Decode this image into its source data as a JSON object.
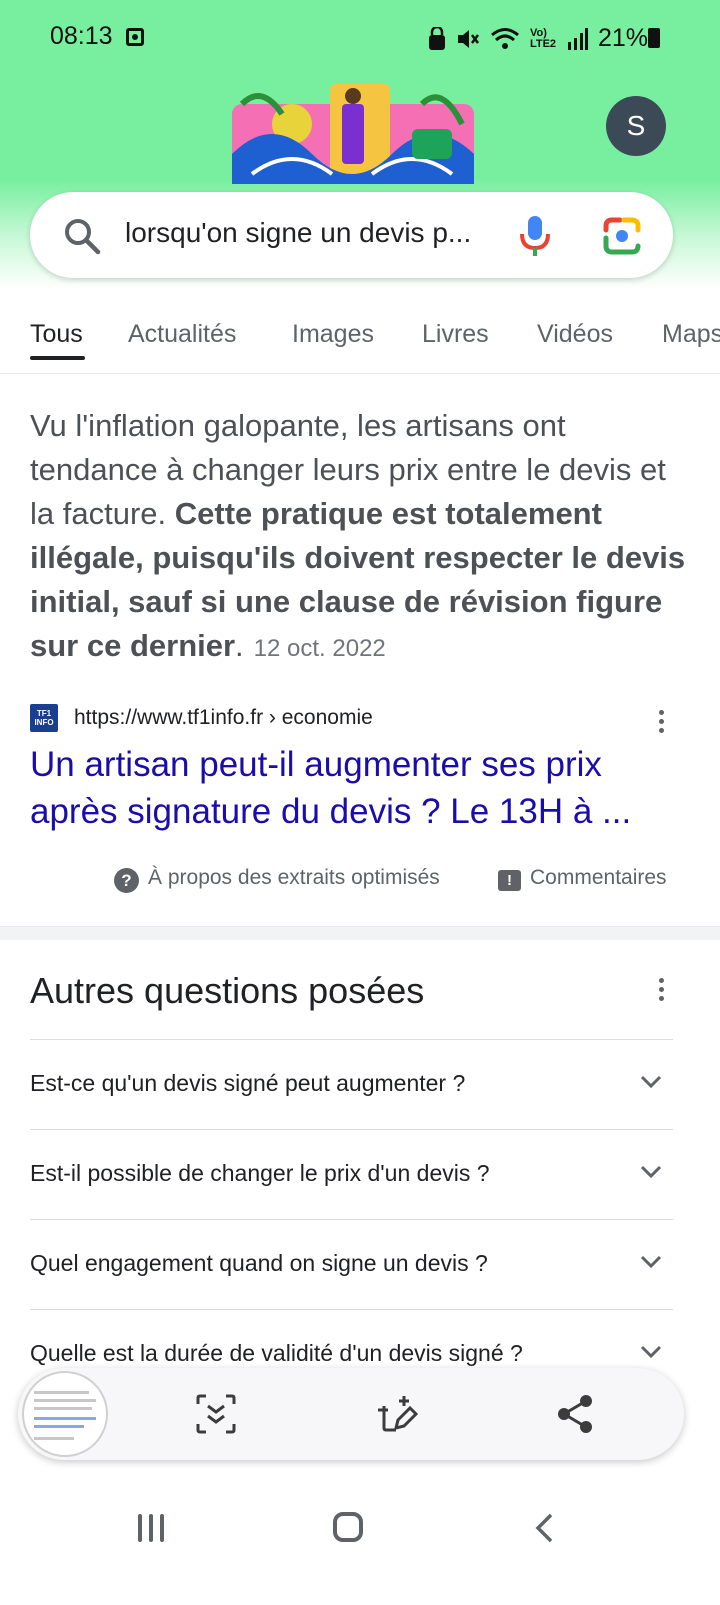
{
  "status_bar": {
    "time": "08:13",
    "network": "Vo) LTE2",
    "battery": "21%"
  },
  "header": {
    "avatar_initial": "S"
  },
  "search": {
    "query": "lorsqu'on signe un devis p..."
  },
  "tabs": [
    {
      "label": "Tous",
      "active": true
    },
    {
      "label": "Actualités",
      "active": false
    },
    {
      "label": "Images",
      "active": false
    },
    {
      "label": "Livres",
      "active": false
    },
    {
      "label": "Vidéos",
      "active": false
    },
    {
      "label": "Maps",
      "active": false
    }
  ],
  "featured_snippet": {
    "text_plain": "Vu l'inflation galopante, les artisans ont tendance à changer leurs prix entre le devis et la facture. ",
    "text_bold": "Cette pratique est totalement illégale, puisqu'ils doivent respecter le devis initial, sauf si une clause de révision figure sur ce dernier",
    "text_end": ".",
    "date": "12 oct. 2022",
    "favicon_text": "TF1 INFO",
    "site_url": "https://www.tf1info.fr › economie",
    "link_title": "Un artisan peut-il augmenter ses prix après signature du devis ? Le 13H à ...",
    "about_label": "À propos des extraits optimisés",
    "feedback_label": "Commentaires"
  },
  "people_also_ask": {
    "title": "Autres questions posées",
    "questions": [
      "Est-ce qu'un devis signé peut augmenter ?",
      "Est-il possible de changer le prix d'un devis ?",
      "Quel engagement quand on signe un devis ?",
      "Quelle est la durée de validité d'un devis signé ?"
    ]
  },
  "screenshot_toolbar": {
    "icons": [
      "thumbnail-preview",
      "scroll-capture-icon",
      "draw-icon",
      "share-icon"
    ]
  },
  "colors": {
    "header_green": "#78ef9f",
    "link_blue": "#1a0dab",
    "avatar_bg": "#3c4a57"
  }
}
